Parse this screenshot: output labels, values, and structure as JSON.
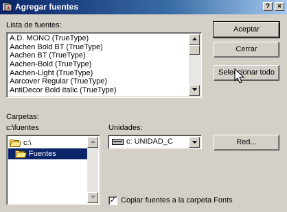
{
  "window": {
    "title": "Agregar fuentes",
    "help_label": "?",
    "close_label": "×"
  },
  "fonts_list": {
    "label": "Lista de fuentes:",
    "items": [
      "A.D. MONO (TrueType)",
      "Aachen Bold BT (TrueType)",
      "Aachen BT (TrueType)",
      "Aachen-Bold (TrueType)",
      "Aachen-Light (TrueType)",
      "Aarcover Regular (TrueType)",
      "AntiDecor Bold Italic (TrueType)"
    ]
  },
  "buttons": {
    "accept": "Aceptar",
    "close": "Cerrar",
    "select_all": "Seleccionar todo",
    "network": "Red..."
  },
  "folders": {
    "label": "Carpetas:",
    "current_path": "c:\\fuentes",
    "tree": [
      "c:\\",
      "Fuentes"
    ]
  },
  "drives": {
    "label": "Unidades:",
    "selected": "c: UNIDAD_C"
  },
  "copy_option": {
    "label": "Copiar fuentes a la carpeta Fonts",
    "checked": true,
    "mark": "✓"
  },
  "colors": {
    "titlebar_start": "#0a246a",
    "titlebar_end": "#a6caf0",
    "selection": "#0a246a",
    "face": "#d4d0c8"
  }
}
